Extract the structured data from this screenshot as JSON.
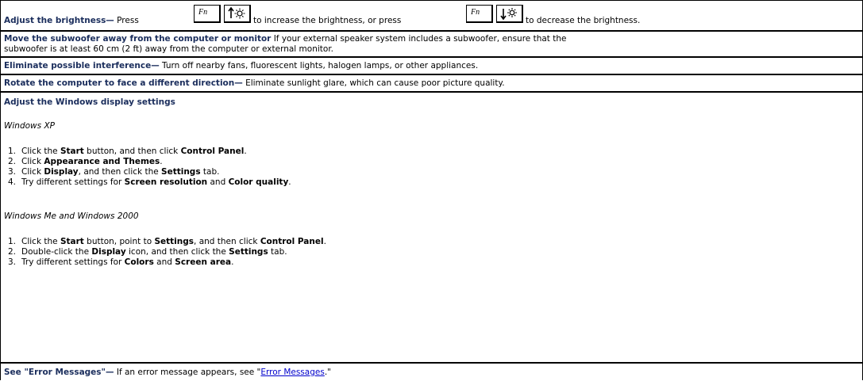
{
  "brightness": {
    "heading": "Adjust the brightness—",
    "t1": " Press",
    "t2": "to increase the brightness, or press",
    "t3": "to decrease the brightness.",
    "fn_key": "Fn"
  },
  "subwoofer": {
    "heading": "Move the subwoofer away from the computer or monitor",
    "text1": " If your external speaker system includes a subwoofer, ensure that the",
    "text2": "subwoofer is at least 60 cm (2 ft) away from the computer or external monitor."
  },
  "interference": {
    "heading": "Eliminate possible interference—",
    "text": " Turn off nearby fans, fluorescent lights, halogen lamps, or other appliances."
  },
  "rotate": {
    "heading": "Rotate the computer to face a different direction—",
    "text": " Eliminate sunlight glare, which can cause poor picture quality."
  },
  "display": {
    "heading": "Adjust the Windows display settings",
    "xp": {
      "title": "Windows XP",
      "steps": [
        {
          "n": "1.",
          "parts": [
            {
              "t": "Click the "
            },
            {
              "t": "Start",
              "b": true
            },
            {
              "t": " button, and then click "
            },
            {
              "t": "Control Panel",
              "b": true
            },
            {
              "t": "."
            }
          ]
        },
        {
          "n": "2.",
          "parts": [
            {
              "t": "Click "
            },
            {
              "t": "Appearance and Themes",
              "b": true
            },
            {
              "t": "."
            }
          ]
        },
        {
          "n": "3.",
          "parts": [
            {
              "t": "Click "
            },
            {
              "t": "Display",
              "b": true
            },
            {
              "t": ", and then click the "
            },
            {
              "t": "Settings",
              "b": true
            },
            {
              "t": " tab."
            }
          ]
        },
        {
          "n": "4.",
          "parts": [
            {
              "t": "Try different settings for "
            },
            {
              "t": "Screen resolution",
              "b": true
            },
            {
              "t": " and "
            },
            {
              "t": "Color quality",
              "b": true
            },
            {
              "t": "."
            }
          ]
        }
      ]
    },
    "me": {
      "title": "Windows Me and Windows 2000",
      "steps": [
        {
          "n": "1.",
          "parts": [
            {
              "t": "Click the "
            },
            {
              "t": "Start",
              "b": true
            },
            {
              "t": " button, point to "
            },
            {
              "t": "Settings",
              "b": true
            },
            {
              "t": ", and then click "
            },
            {
              "t": "Control Panel",
              "b": true
            },
            {
              "t": "."
            }
          ]
        },
        {
          "n": "2.",
          "parts": [
            {
              "t": "Double-click the "
            },
            {
              "t": "Display",
              "b": true
            },
            {
              "t": " icon, and then click the "
            },
            {
              "t": "Settings",
              "b": true
            },
            {
              "t": " tab."
            }
          ]
        },
        {
          "n": "3.",
          "parts": [
            {
              "t": "Try different settings for "
            },
            {
              "t": "Colors",
              "b": true
            },
            {
              "t": " and "
            },
            {
              "t": "Screen area",
              "b": true
            },
            {
              "t": "."
            }
          ]
        }
      ]
    }
  },
  "errors": {
    "heading": "See \"Error Messages\"—",
    "text1": " If an error message appears, see \"",
    "link": "Error Messages",
    "text2": ".\""
  },
  "icons": {
    "brightness_up": "brightness-up-key-icon",
    "brightness_down": "brightness-down-key-icon"
  }
}
